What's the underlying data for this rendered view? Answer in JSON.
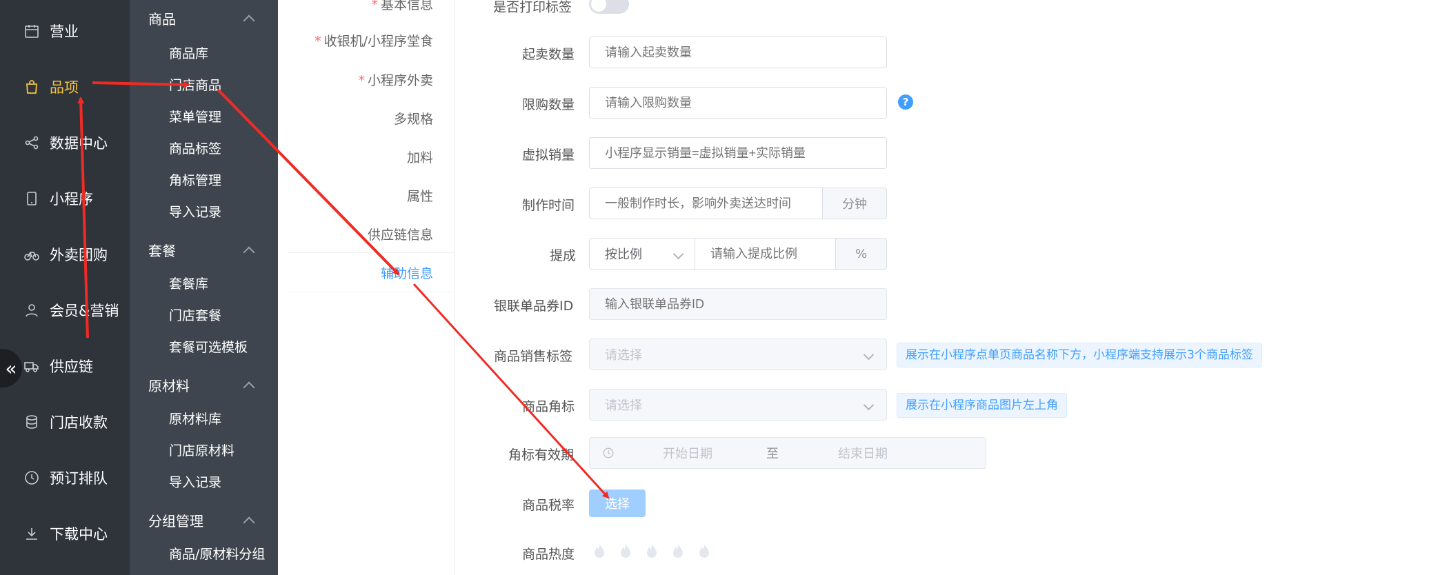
{
  "main_nav": {
    "items": [
      {
        "label": "营业",
        "icon": "calendar-icon"
      },
      {
        "label": "品项",
        "icon": "shopping-bag-icon",
        "active": true
      },
      {
        "label": "数据中心",
        "icon": "share-icon"
      },
      {
        "label": "小程序",
        "icon": "mobile-icon"
      },
      {
        "label": "外卖团购",
        "icon": "bicycle-icon"
      },
      {
        "label": "会员&营销",
        "icon": "user-icon"
      },
      {
        "label": "供应链",
        "icon": "truck-icon"
      },
      {
        "label": "门店收款",
        "icon": "database-icon"
      },
      {
        "label": "预订排队",
        "icon": "clock-icon"
      },
      {
        "label": "下载中心",
        "icon": "download-icon"
      }
    ],
    "collapse_glyph": "«"
  },
  "sub_nav": {
    "groups": [
      {
        "title": "商品",
        "items": [
          "商品库",
          "门店商品",
          "菜单管理",
          "商品标签",
          "角标管理",
          "导入记录"
        ]
      },
      {
        "title": "套餐",
        "items": [
          "套餐库",
          "门店套餐",
          "套餐可选模板"
        ]
      },
      {
        "title": "原材料",
        "items": [
          "原材料库",
          "门店原材料",
          "导入记录"
        ]
      },
      {
        "title": "分组管理",
        "items": [
          "商品/原材料分组"
        ]
      }
    ]
  },
  "tabs": {
    "items": [
      {
        "label": "基本信息",
        "required": true
      },
      {
        "label": "收银机/小程序堂食",
        "required": true
      },
      {
        "label": "小程序外卖",
        "required": true
      },
      {
        "label": "多规格",
        "required": false
      },
      {
        "label": "加料",
        "required": false
      },
      {
        "label": "属性",
        "required": false
      },
      {
        "label": "供应链信息",
        "required": false
      },
      {
        "label": "辅助信息",
        "required": false,
        "active": true
      }
    ],
    "required_mark": "*"
  },
  "form": {
    "print_label": {
      "label": "是否打印标签"
    },
    "min_qty": {
      "label": "起卖数量",
      "placeholder": "请输入起卖数量"
    },
    "limit_qty": {
      "label": "限购数量",
      "placeholder": "请输入限购数量",
      "help": "?"
    },
    "virtual_sales": {
      "label": "虚拟销量",
      "placeholder": "小程序显示销量=虚拟销量+实际销量"
    },
    "make_time": {
      "label": "制作时间",
      "placeholder": "一般制作时长，影响外卖送达时间",
      "unit": "分钟"
    },
    "commission": {
      "label": "提成",
      "mode": "按比例",
      "placeholder": "请输入提成比例",
      "unit": "%"
    },
    "unionpay_id": {
      "label": "银联单品券ID",
      "placeholder": "输入银联单品券ID"
    },
    "sale_tag": {
      "label": "商品销售标签",
      "placeholder": "请选择",
      "hint": "展示在小程序点单页商品名称下方，小程序端支持展示3个商品标签"
    },
    "corner_mark": {
      "label": "商品角标",
      "placeholder": "请选择",
      "hint": "展示在小程序商品图片左上角"
    },
    "corner_period": {
      "label": "角标有效期",
      "start": "开始日期",
      "sep": "至",
      "end": "结束日期"
    },
    "tax_rate": {
      "label": "商品税率",
      "button": "选择"
    },
    "heat": {
      "label": "商品热度",
      "rating": 0,
      "max": 5
    }
  },
  "colors": {
    "accent": "#409eff",
    "nav_active": "#f7c33a",
    "arrow": "#f02b24"
  }
}
